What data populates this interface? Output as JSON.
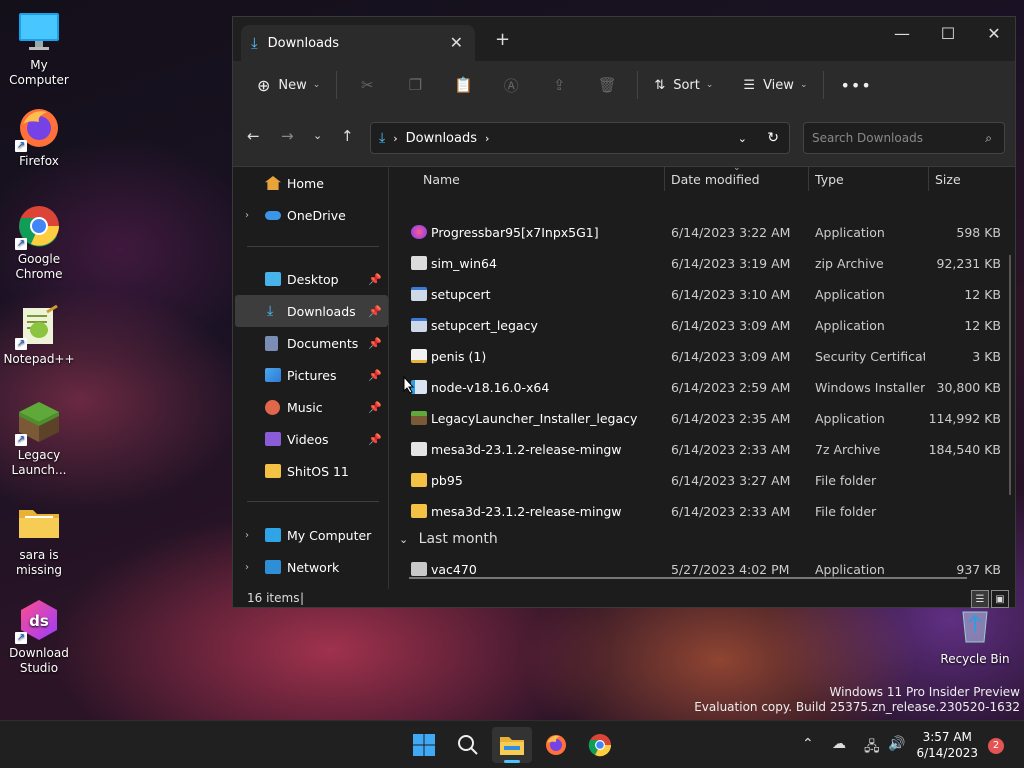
{
  "desktop": {
    "icons": [
      {
        "label": "My Computer"
      },
      {
        "label": "Firefox"
      },
      {
        "label": "Google Chrome"
      },
      {
        "label": "Notepad++"
      },
      {
        "label": "Legacy Launch..."
      },
      {
        "label": "sara is missing"
      },
      {
        "label": "Download Studio"
      },
      {
        "label": "Recycle Bin"
      }
    ],
    "watermark": {
      "line1": "Windows 11 Pro Insider Preview",
      "line2": "Evaluation copy. Build 25375.zn_release.230520-1632"
    }
  },
  "window": {
    "tab_title": "Downloads",
    "toolbar": {
      "new_label": "New",
      "sort_label": "Sort",
      "view_label": "View"
    },
    "address": {
      "path": "Downloads"
    },
    "search": {
      "placeholder": "Search Downloads"
    },
    "sidebar": {
      "items": [
        {
          "label": "Home"
        },
        {
          "label": "OneDrive"
        },
        {
          "label": "Desktop"
        },
        {
          "label": "Downloads"
        },
        {
          "label": "Documents"
        },
        {
          "label": "Pictures"
        },
        {
          "label": "Music"
        },
        {
          "label": "Videos"
        },
        {
          "label": "ShitOS 11"
        },
        {
          "label": "My Computer"
        },
        {
          "label": "Network"
        }
      ]
    },
    "columns": {
      "name": "Name",
      "date": "Date modified",
      "type": "Type",
      "size": "Size"
    },
    "files": [
      {
        "name": "Progressbar95[x7Inpx5G1]",
        "date": "6/14/2023 3:22 AM",
        "type": "Application",
        "size": "598 KB"
      },
      {
        "name": "sim_win64",
        "date": "6/14/2023 3:19 AM",
        "type": "zip Archive",
        "size": "92,231 KB"
      },
      {
        "name": "setupcert",
        "date": "6/14/2023 3:10 AM",
        "type": "Application",
        "size": "12 KB"
      },
      {
        "name": "setupcert_legacy",
        "date": "6/14/2023 3:09 AM",
        "type": "Application",
        "size": "12 KB"
      },
      {
        "name": "penis (1)",
        "date": "6/14/2023 3:09 AM",
        "type": "Security Certificate",
        "size": "3 KB"
      },
      {
        "name": "node-v18.16.0-x64",
        "date": "6/14/2023 2:59 AM",
        "type": "Windows Installer ...",
        "size": "30,800 KB"
      },
      {
        "name": "LegacyLauncher_Installer_legacy",
        "date": "6/14/2023 2:35 AM",
        "type": "Application",
        "size": "114,992 KB"
      },
      {
        "name": "mesa3d-23.1.2-release-mingw",
        "date": "6/14/2023 2:33 AM",
        "type": "7z Archive",
        "size": "184,540 KB"
      },
      {
        "name": "pb95",
        "date": "6/14/2023 3:27 AM",
        "type": "File folder",
        "size": ""
      },
      {
        "name": "mesa3d-23.1.2-release-mingw",
        "date": "6/14/2023 2:33 AM",
        "type": "File folder",
        "size": ""
      }
    ],
    "group_last_month": "Last month",
    "files_last_month": [
      {
        "name": "vac470",
        "date": "5/27/2023 4:02 PM",
        "type": "Application",
        "size": "937 KB"
      }
    ],
    "status": {
      "item_count": "16 items"
    }
  },
  "taskbar": {
    "clock_time": "3:57 AM",
    "clock_date": "6/14/2023",
    "notification_count": "2"
  },
  "colors": {
    "accent": "#4cc2ff",
    "folder": "#f3c244",
    "selection": "#3d3d3d"
  }
}
